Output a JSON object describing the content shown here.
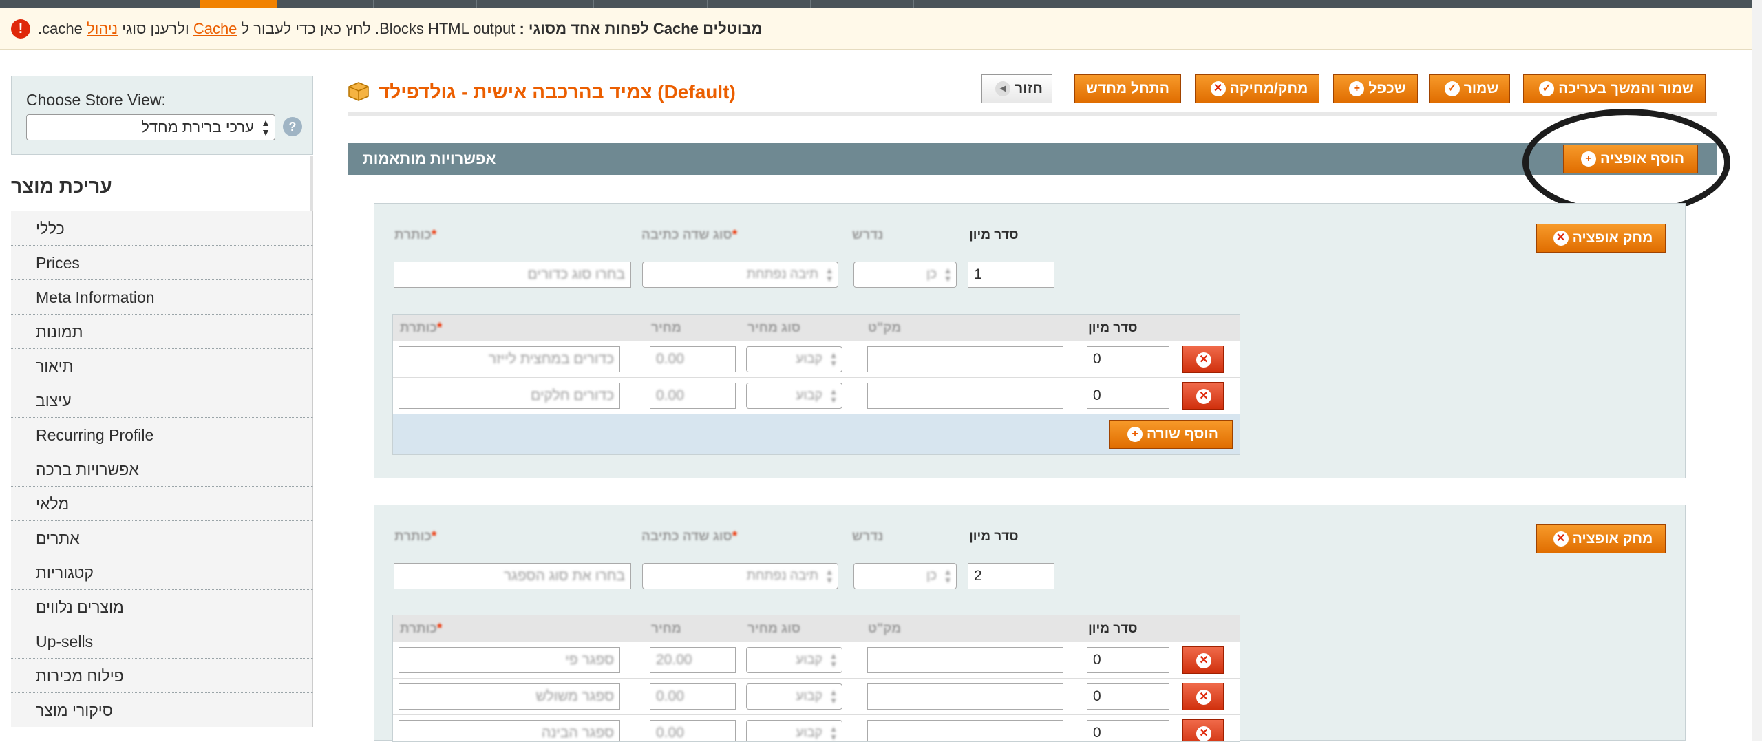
{
  "notice": {
    "text_bold": "מבוטלים Cache לפחות אחד מסוגי :",
    "text_plain": " Blocks HTML output. לחץ כאן כדי לעבור ל ",
    "link_cache": "Cache",
    "text_mid": " ולרענן סוגי ",
    "link_manage": "ניהול",
    "text_end": " cache."
  },
  "sidebar": {
    "store_view_label": "Choose Store View:",
    "store_view_value": "ערכי ברירת מחדל",
    "heading": "עריכת מוצר",
    "items": [
      {
        "label": "כללי"
      },
      {
        "label": "Prices"
      },
      {
        "label": "Meta Information"
      },
      {
        "label": "תמונות"
      },
      {
        "label": "תיאור"
      },
      {
        "label": "עיצוב"
      },
      {
        "label": "Recurring Profile"
      },
      {
        "label": "אפשרויות ברכה"
      },
      {
        "label": "מלאי"
      },
      {
        "label": "אתרים"
      },
      {
        "label": "קטגוריות"
      },
      {
        "label": "מוצרים נלווים"
      },
      {
        "label": "Up-sells"
      },
      {
        "label": "פילוח מכירות"
      },
      {
        "label": "סיקורי מוצר"
      }
    ]
  },
  "header": {
    "title": "צמיד בהרכבה אישית - גולדפילד (Default)",
    "buttons": {
      "back": "חזור",
      "reset": "התחל מחדש",
      "delete": "מחק/מחיקה",
      "duplicate": "שכפל",
      "save": "שמור",
      "save_continue": "שמור והמשך בעריכה"
    }
  },
  "section": {
    "title": "אפשרויות מותאמות",
    "add_option": "הוסף אופציה",
    "delete_option": "מחק אופציה",
    "add_row": "הוסף שורה",
    "labels": {
      "title": "כותרת",
      "input_type": "סוג שדה כתיבה",
      "required": "נדרש",
      "sort_order": "סדר מיון"
    },
    "grid_headers": {
      "title": "כותרת",
      "price": "מחיר",
      "price_type": "סוג מחיר",
      "sku": "מק\"ט",
      "sort_order": "סדר מיון"
    },
    "options": [
      {
        "title": "בחרו סוג כדורים",
        "input_type": "תיבה נפתחת",
        "required": "כן",
        "sort_order": "1",
        "rows": [
          {
            "title": "כדורים במחצית לייזר",
            "price": "0.00",
            "price_type": "קבוע",
            "sku": "",
            "sort": "0"
          },
          {
            "title": "כדורים חלקים",
            "price": "0.00",
            "price_type": "קבוע",
            "sku": "",
            "sort": "0"
          }
        ]
      },
      {
        "title": "בחרו את סוג הספגר",
        "input_type": "תיבה נפתחת",
        "required": "כן",
        "sort_order": "2",
        "rows": [
          {
            "title": "ספגר פי",
            "price": "20.00",
            "price_type": "קבוע",
            "sku": "",
            "sort": "0"
          },
          {
            "title": "ספגר משולש",
            "price": "0.00",
            "price_type": "קבוע",
            "sku": "",
            "sort": "0"
          },
          {
            "title": "ספגר הבינה",
            "price": "0.00",
            "price_type": "קבוע",
            "sku": "",
            "sort": "0"
          }
        ]
      }
    ]
  },
  "colors": {
    "accent": "#eb5e00",
    "button": "#f18200",
    "section_header": "#6f8992",
    "delete_red": "#df280a"
  }
}
